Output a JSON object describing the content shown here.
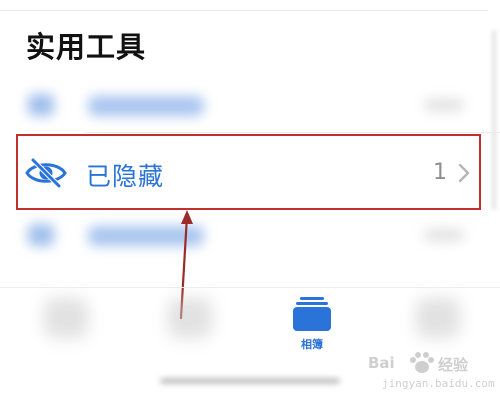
{
  "section": {
    "title": "实用工具"
  },
  "hidden_row": {
    "label": "已隐藏",
    "count": "1"
  },
  "tab_bar": {
    "albums_label": "相簿"
  },
  "watermark": {
    "brand_left": "Bai",
    "brand_right": "经验",
    "url": "jingyan.baidu.com"
  },
  "colors": {
    "accent_blue": "#2a74d9",
    "highlight_red": "#c12f2f",
    "annotation_arrow": "#9c2a2a",
    "secondary_gray": "#8e8e93"
  },
  "icons": {
    "hidden_row_icon": "eye-slash-icon",
    "row_chevron": "chevron-right-icon",
    "albums_tab_icon": "albums-stack-icon",
    "watermark_logo": "baidu-paw-icon"
  }
}
